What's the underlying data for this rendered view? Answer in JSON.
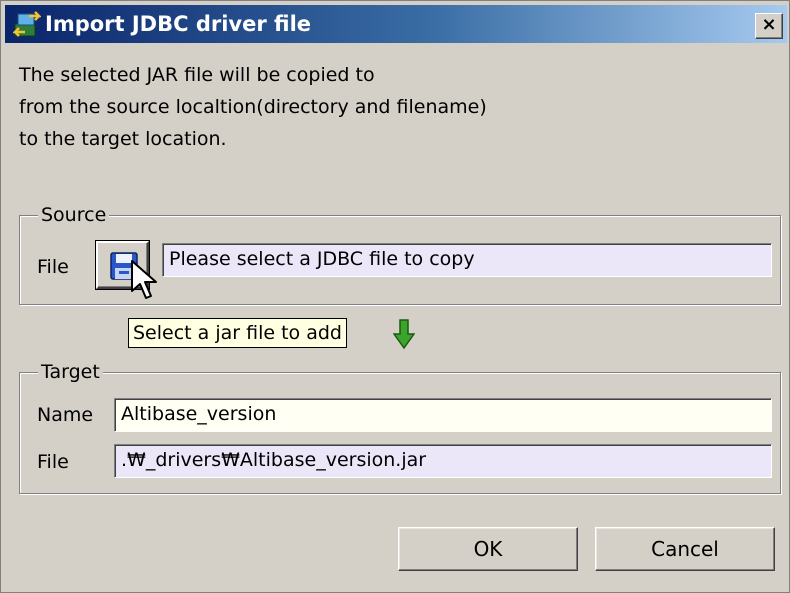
{
  "window": {
    "title": "Import JDBC driver file",
    "close_glyph": "×"
  },
  "description": {
    "lines": [
      "The selected JAR file will be copied to",
      "from the source localtion(directory and filename)",
      "to the target location."
    ]
  },
  "source": {
    "group_label": "Source",
    "file_label": "File",
    "file_button_icon": "floppy-disk-icon",
    "file_value": "Please select a JDBC file to copy",
    "tooltip": "Select a jar file to add"
  },
  "target": {
    "group_label": "Target",
    "name_label": "Name",
    "name_value": "Altibase_version",
    "file_label": "File",
    "file_value": ".₩_drivers₩Altibase_version.jar"
  },
  "buttons": {
    "ok": "OK",
    "cancel": "Cancel"
  },
  "colors": {
    "title_gradient_start": "#0a246a",
    "title_gradient_end": "#a6caf0",
    "dialog_bg": "#d4d0c8",
    "lavender_field": "#ece6f9",
    "cream_field": "#fffff3",
    "tooltip_bg": "#ffffe1",
    "arrow_green": "#3aa52a"
  }
}
